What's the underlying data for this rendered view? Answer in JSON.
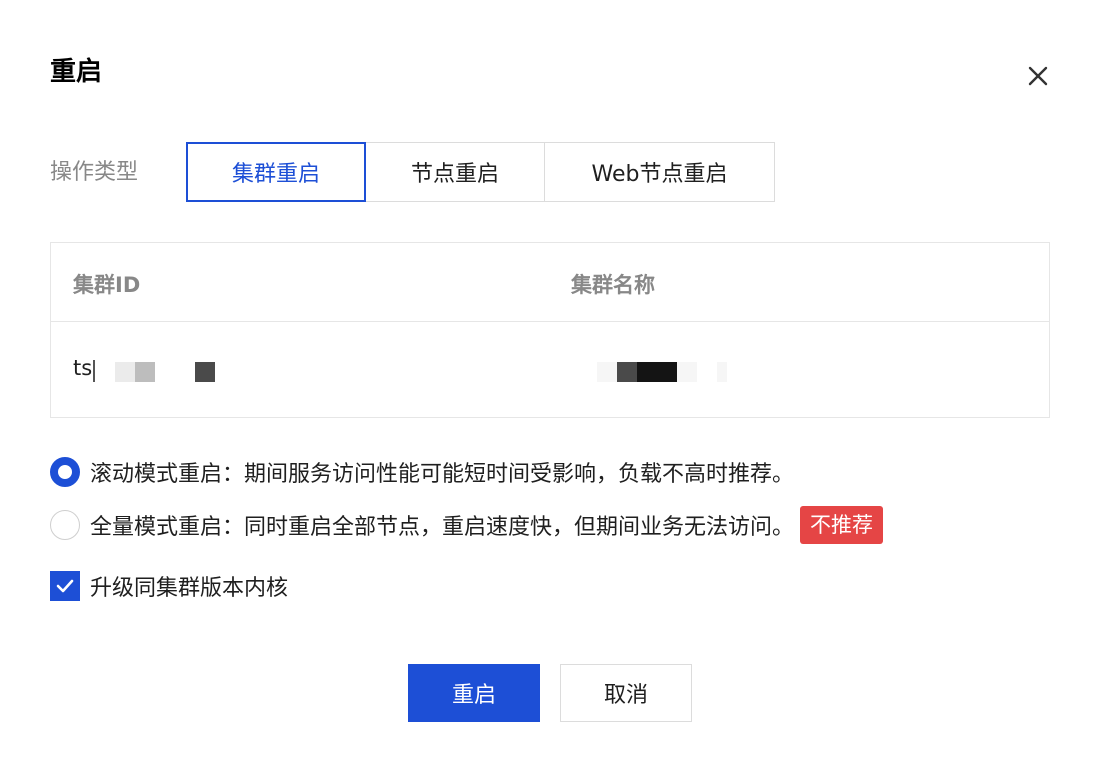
{
  "dialog": {
    "title": "重启"
  },
  "operation": {
    "label": "操作类型",
    "options": [
      "集群重启",
      "节点重启",
      "Web节点重启"
    ],
    "selected": "集群重启"
  },
  "table": {
    "columns": [
      "集群ID",
      "集群名称"
    ],
    "rows": [
      {
        "id_visible": "ts"
      }
    ]
  },
  "restart_mode": {
    "options": [
      {
        "label": "滚动模式重启：期间服务访问性能可能短时间受影响，负载不高时推荐。",
        "checked": true
      },
      {
        "label": "全量模式重启：同时重启全部节点，重启速度快，但期间业务无法访问。",
        "checked": false,
        "badge": "不推荐"
      }
    ]
  },
  "upgrade_kernel": {
    "label": "升级同集群版本内核",
    "checked": true
  },
  "footer": {
    "confirm": "重启",
    "cancel": "取消"
  },
  "colors": {
    "primary": "#1d4fd6",
    "danger": "#e54545"
  }
}
